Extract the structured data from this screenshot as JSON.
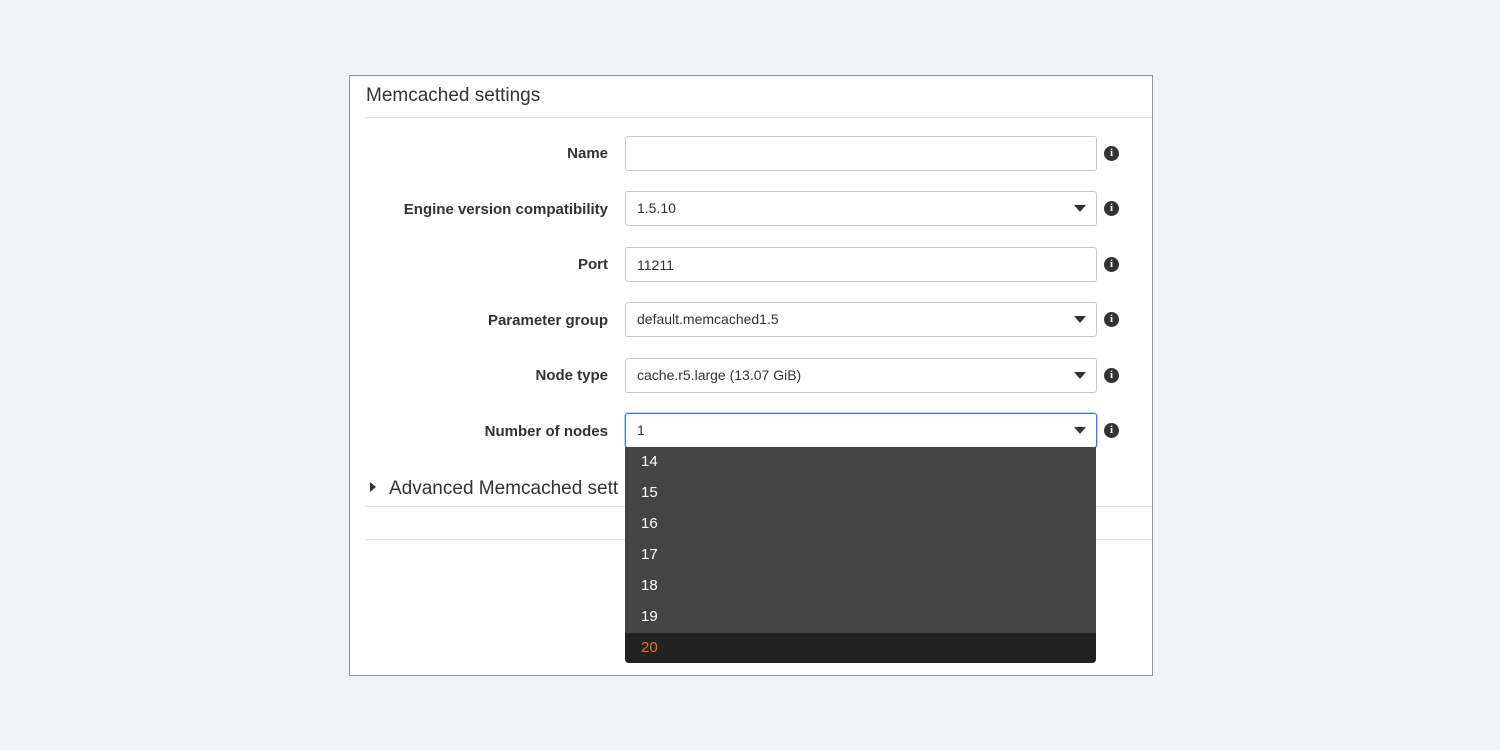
{
  "panel": {
    "title": "Memcached settings"
  },
  "form": {
    "name": {
      "label": "Name",
      "value": ""
    },
    "engine_version": {
      "label": "Engine version compatibility",
      "value": "1.5.10"
    },
    "port": {
      "label": "Port",
      "value": "11211"
    },
    "parameter_group": {
      "label": "Parameter group",
      "value": "default.memcached1.5"
    },
    "node_type": {
      "label": "Node type",
      "value": "cache.r5.large (13.07 GiB)"
    },
    "number_of_nodes": {
      "label": "Number of nodes",
      "value": "1"
    }
  },
  "info_icon_glyph": "i",
  "advanced": {
    "label": "Advanced Memcached sett"
  },
  "dropdown": {
    "items": [
      "14",
      "15",
      "16",
      "17",
      "18",
      "19",
      "20"
    ],
    "highlighted": "20"
  },
  "colors": {
    "focus_border": "#3d7bd7",
    "dropdown_bg": "#444444",
    "dropdown_highlight_bg": "#222222",
    "dropdown_highlight_text": "#ec7211"
  }
}
